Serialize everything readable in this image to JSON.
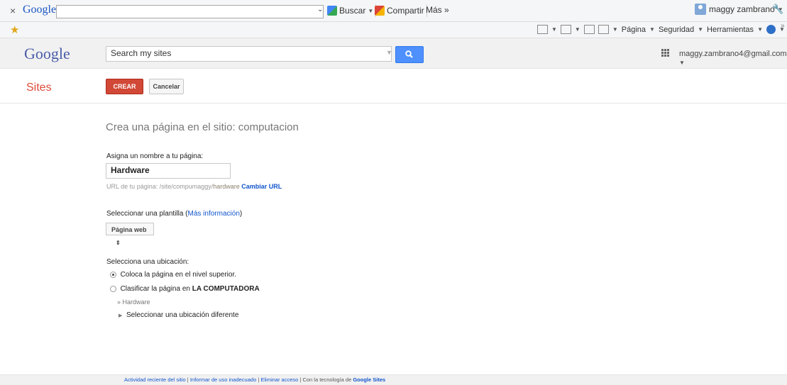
{
  "browser_toolbar": {
    "close": "×",
    "brand": "Google",
    "buscar": "Buscar",
    "compartir": "Compartir",
    "mas": "Más »",
    "user": "maggy zambrano"
  },
  "command_bar": {
    "pagina": "Página",
    "seguridad": "Seguridad",
    "herramientas": "Herramientas"
  },
  "header": {
    "logo": "Google",
    "search_value": "Search my sites",
    "account": "maggy.zambrano4@gmail.com"
  },
  "actions": {
    "sites_title": "Sites",
    "crear": "CREAR",
    "cancelar": "Cancelar"
  },
  "form": {
    "heading": "Crea una página en el sitio: computacion",
    "name_label": "Asigna un nombre a tu página:",
    "name_value": "Hardware",
    "url_prefix": "URL de tu página: /site/compumaggy/",
    "url_slug": "hardware",
    "url_change": "Cambiar URL",
    "template_label": "Seleccionar una plantilla",
    "template_more": "Más información",
    "template_value": "Página web",
    "location_label": "Selecciona una ubicación:",
    "option_top": "Coloca la página en el nivel superior.",
    "option_under_prefix": "Clasificar la página en",
    "option_under_parent": "LA COMPUTADORA",
    "breadcrumb": "» Hardware",
    "other_location": "Seleccionar una ubicación diferente"
  },
  "footer": {
    "recent": "Actividad reciente del sitio",
    "report": "Informar de uso inadecuado",
    "remove": "Eliminar acceso",
    "powered": "Con la tecnología de",
    "gsites": "Google Sites"
  }
}
